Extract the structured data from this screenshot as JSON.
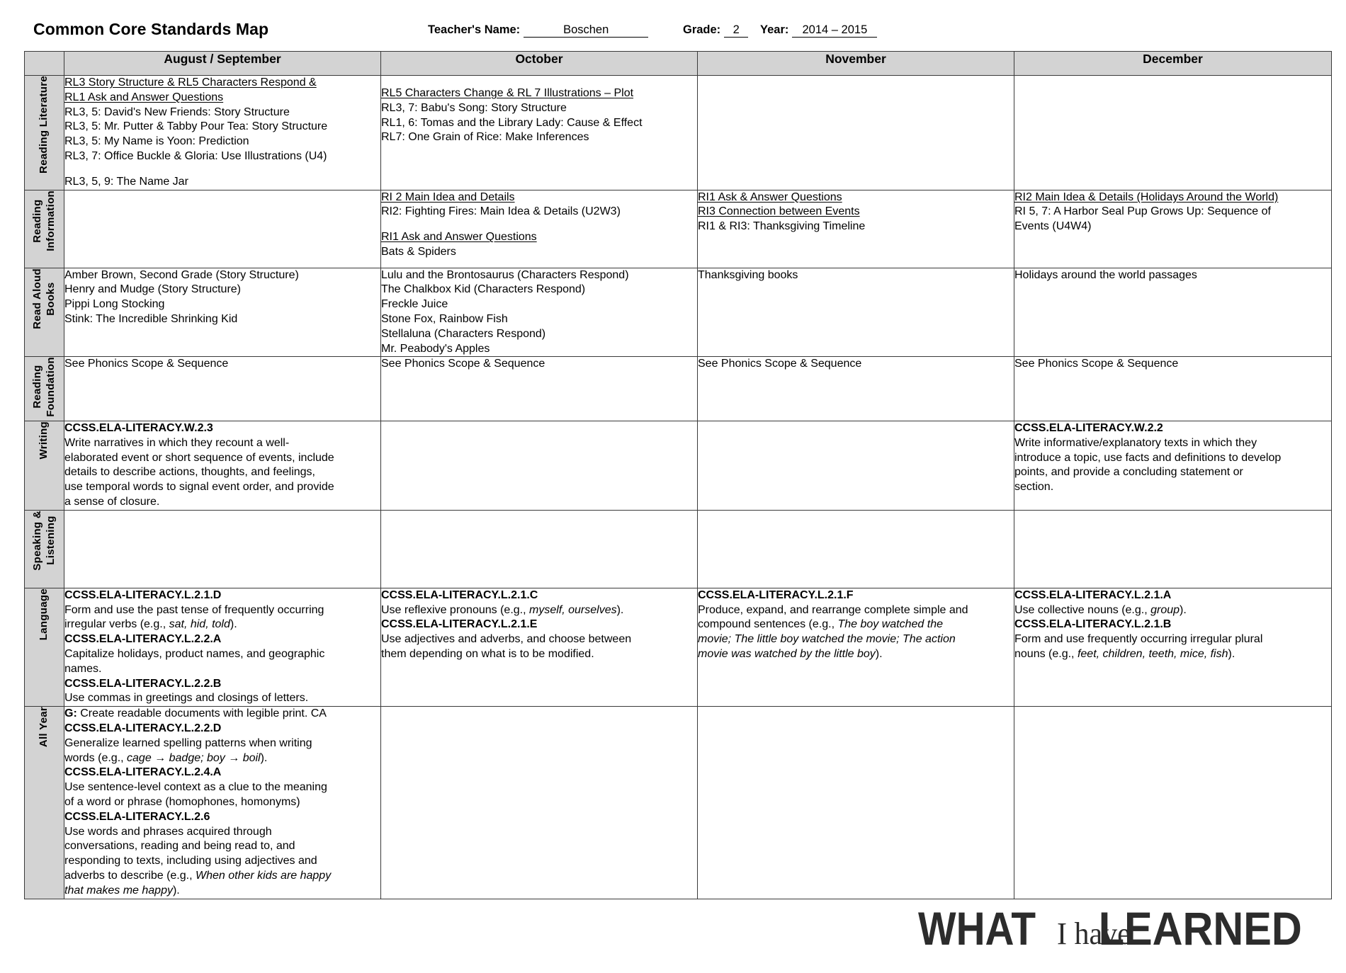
{
  "header": {
    "title": "Common Core Standards Map",
    "teacher_label": "Teacher's Name:",
    "teacher_value": "Boschen",
    "grade_label": "Grade:",
    "grade_value": "2",
    "year_label": "Year:",
    "year_value": "2014 – 2015"
  },
  "table": {
    "corner": "",
    "columns": [
      "August / September",
      "October",
      "November",
      "December"
    ],
    "rows": [
      {
        "label": "Reading Literature",
        "cells": [
          [
            {
              "t": "RL3 Story Structure & RL5 Characters Respond &",
              "u": true
            },
            {
              "t": "RL1 Ask and Answer Questions",
              "u": true
            },
            {
              "t": "RL3, 5: David's New Friends: Story Structure"
            },
            {
              "t": "RL3, 5: Mr. Putter & Tabby Pour Tea: Story Structure"
            },
            {
              "t": "RL3, 5: My Name is Yoon: Prediction"
            },
            {
              "t": "RL3, 7: Office Buckle & Gloria: Use Illustrations (U4)"
            },
            {
              "spacer": true
            },
            {
              "t": "RL3, 5, 9: The Name Jar"
            }
          ],
          [
            {
              "spacer": true
            },
            {
              "t": "RL5 Characters Change & RL 7 Illustrations – Plot",
              "u": true
            },
            {
              "t": "RL3, 7: Babu's Song: Story Structure"
            },
            {
              "t": "RL1, 6: Tomas and the Library Lady: Cause & Effect"
            },
            {
              "t": "RL7: One Grain of Rice: Make Inferences"
            }
          ],
          [],
          []
        ]
      },
      {
        "label": "Reading\nInformation",
        "cells": [
          [],
          [
            {
              "t": "RI 2 Main Idea and Details",
              "u": true
            },
            {
              "t": "RI2: Fighting Fires: Main Idea & Details (U2W3)"
            },
            {
              "spacer": true
            },
            {
              "t": "RI1 Ask and Answer Questions",
              "u": true
            },
            {
              "t": "Bats & Spiders"
            }
          ],
          [
            {
              "t": "RI1 Ask & Answer Questions",
              "u": true
            },
            {
              "t": "RI3 Connection between Events",
              "u": true
            },
            {
              "t": "RI1 & RI3: Thanksgiving Timeline"
            }
          ],
          [
            {
              "t": "RI2 Main Idea & Details (Holidays Around the World)",
              "u": true
            },
            {
              "t": "RI 5, 7: A Harbor Seal Pup Grows Up: Sequence of"
            },
            {
              "t": "Events (U4W4)"
            }
          ]
        ]
      },
      {
        "label": "Read Aloud\nBooks",
        "cells": [
          [
            {
              "t": "Amber Brown, Second Grade (Story Structure)"
            },
            {
              "t": "Henry and Mudge (Story Structure)"
            },
            {
              "t": "Pippi Long Stocking"
            },
            {
              "t": "Stink: The Incredible Shrinking Kid"
            }
          ],
          [
            {
              "t": "Lulu and the Brontosaurus (Characters Respond)"
            },
            {
              "t": "The Chalkbox Kid (Characters Respond)"
            },
            {
              "t": "Freckle Juice"
            },
            {
              "t": "Stone Fox, Rainbow Fish"
            },
            {
              "t": "Stellaluna (Characters Respond)"
            },
            {
              "t": "Mr. Peabody's Apples"
            }
          ],
          [
            {
              "t": "Thanksgiving books"
            }
          ],
          [
            {
              "t": "Holidays around the world passages"
            }
          ]
        ]
      },
      {
        "label": "Reading\nFoundation",
        "cells": [
          [
            {
              "t": "See Phonics Scope & Sequence"
            }
          ],
          [
            {
              "t": "See Phonics Scope & Sequence"
            }
          ],
          [
            {
              "t": "See Phonics Scope & Sequence"
            }
          ],
          [
            {
              "t": "See Phonics Scope & Sequence"
            }
          ]
        ]
      },
      {
        "label": "Writing",
        "cells": [
          [
            {
              "t": "CCSS.ELA-LITERACY.W.2.3",
              "b": true
            },
            {
              "t": "Write narratives in which they recount a well-"
            },
            {
              "t": "elaborated event or short sequence of events, include"
            },
            {
              "t": "details to describe actions, thoughts, and feelings,"
            },
            {
              "t": "use temporal words to signal event order, and provide"
            },
            {
              "t": "a sense of closure."
            }
          ],
          [],
          [],
          [
            {
              "t": "CCSS.ELA-LITERACY.W.2.2",
              "b": true
            },
            {
              "t": "Write informative/explanatory texts in which they"
            },
            {
              "t": "introduce a topic, use facts and definitions to develop"
            },
            {
              "t": "points, and provide a concluding statement or"
            },
            {
              "t": "section."
            }
          ]
        ]
      },
      {
        "label": "Speaking &\nListening",
        "cells": [
          [],
          [],
          [],
          []
        ]
      },
      {
        "label": "Language",
        "cells": [
          [
            {
              "t": "CCSS.ELA-LITERACY.L.2.1.D",
              "b": true
            },
            {
              "t": "Form and use the past tense of frequently occurring"
            },
            {
              "h": "irregular verbs (e.g., <i>sat, hid, told</i>)."
            },
            {
              "t": "CCSS.ELA-LITERACY.L.2.2.A",
              "b": true
            },
            {
              "t": "Capitalize holidays, product names, and geographic"
            },
            {
              "t": "names."
            },
            {
              "t": "CCSS.ELA-LITERACY.L.2.2.B",
              "b": true
            },
            {
              "t": "Use commas in greetings and closings of letters."
            }
          ],
          [
            {
              "t": "CCSS.ELA-LITERACY.L.2.1.C",
              "b": true
            },
            {
              "h": "Use reflexive pronouns (e.g., <i>myself, ourselves</i>)."
            },
            {
              "t": "CCSS.ELA-LITERACY.L.2.1.E",
              "b": true
            },
            {
              "t": "Use adjectives and adverbs, and choose between"
            },
            {
              "t": "them depending on what is to be modified."
            }
          ],
          [
            {
              "t": "CCSS.ELA-LITERACY.L.2.1.F",
              "b": true
            },
            {
              "t": "Produce, expand, and rearrange complete simple and"
            },
            {
              "h": "compound sentences (e.g., <i>The boy watched the</i>"
            },
            {
              "h": "<i>movie; The little boy watched the movie; The action</i>"
            },
            {
              "h": "<i>movie was watched by the little boy</i>)."
            }
          ],
          [
            {
              "t": "CCSS.ELA-LITERACY.L.2.1.A",
              "b": true
            },
            {
              "h": "Use collective nouns (e.g., <i>group</i>)."
            },
            {
              "t": "CCSS.ELA-LITERACY.L.2.1.B",
              "b": true
            },
            {
              "t": "Form and use frequently occurring irregular plural"
            },
            {
              "h": "nouns (e.g., <i>feet, children, teeth, mice, fish</i>)."
            }
          ]
        ]
      },
      {
        "label": "All Year",
        "cells": [
          [
            {
              "h": "<b>G:</b> Create readable documents with legible print. CA"
            },
            {
              "t": "CCSS.ELA-LITERACY.L.2.2.D",
              "b": true
            },
            {
              "t": "Generalize learned spelling patterns when writing"
            },
            {
              "h": "words (e.g., <i>cage → badge; boy → boil</i>)."
            },
            {
              "t": "CCSS.ELA-LITERACY.L.2.4.A",
              "b": true
            },
            {
              "t": "Use sentence-level context as a clue to the meaning"
            },
            {
              "t": "of a word or phrase (homophones, homonyms)"
            },
            {
              "t": "CCSS.ELA-LITERACY.L.2.6",
              "b": true
            },
            {
              "t": "Use words and phrases acquired through"
            },
            {
              "t": "conversations, reading and being read to, and"
            },
            {
              "t": "responding to texts, including using adjectives and"
            },
            {
              "h": "adverbs to describe (e.g., <i>When other kids are happy</i>"
            },
            {
              "h": "<i>that makes me happy</i>)."
            }
          ],
          [],
          [],
          []
        ]
      }
    ]
  },
  "watermark": {
    "word1": "WHAT",
    "word2": "I have",
    "word3": "LEARNED"
  }
}
